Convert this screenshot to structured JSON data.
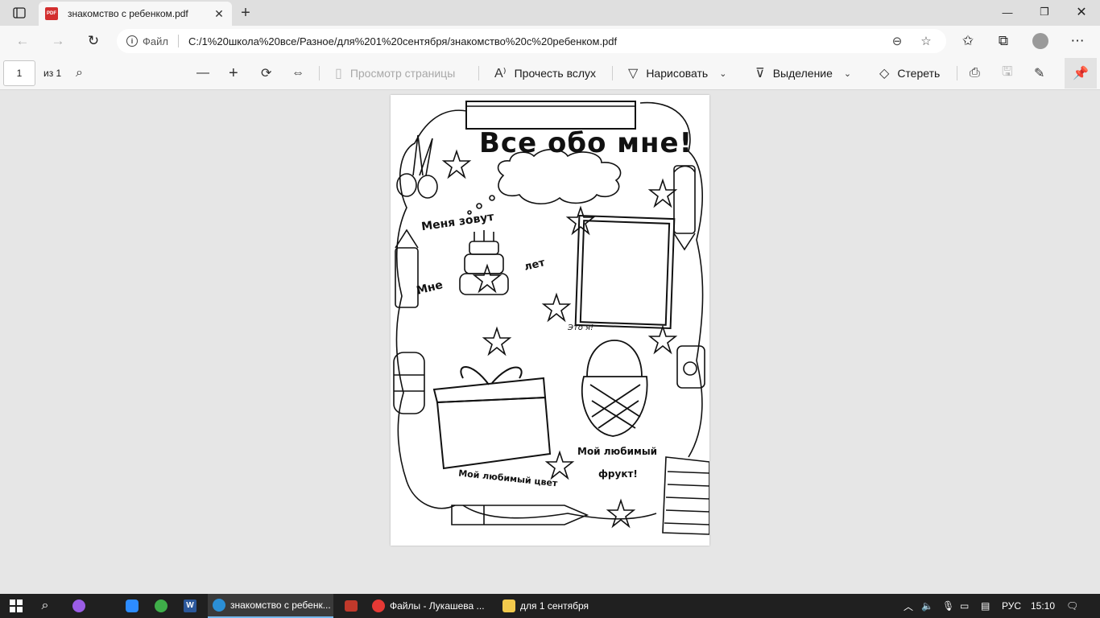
{
  "browser": {
    "tab_title": "знакомство с ребенком.pdf",
    "scheme_label": "Файл",
    "url": "C:/1%20школа%20все/Разное/для%201%20сентября/знакомство%20с%20ребенком.pdf"
  },
  "pdf_toolbar": {
    "page_number": "1",
    "page_total": "из 1",
    "page_view": "Просмотр страницы",
    "read_aloud": "Прочесть вслух",
    "draw": "Нарисовать",
    "highlight": "Выделение",
    "erase": "Стереть"
  },
  "document": {
    "heading": "Все обо мне!",
    "name_label": "Меня зовут",
    "age_prefix": "Мне",
    "age_suffix": "лет",
    "photo_caption": "Это я!",
    "favorite_color": "Мой любимый цвет",
    "favorite_fruit_line1": "Мой любимый",
    "favorite_fruit_line2": "фрукт!"
  },
  "taskbar": {
    "apps": [
      {
        "label": "знакомство с ребенк...",
        "color": "#2b8fd6",
        "active": true
      },
      {
        "label": "Файлы - Лукашева ...",
        "color": "#e53935",
        "active": false
      },
      {
        "label": "для 1 сентября",
        "color": "#f2c94c",
        "active": false
      }
    ],
    "language": "РУС",
    "time": "15:10"
  }
}
